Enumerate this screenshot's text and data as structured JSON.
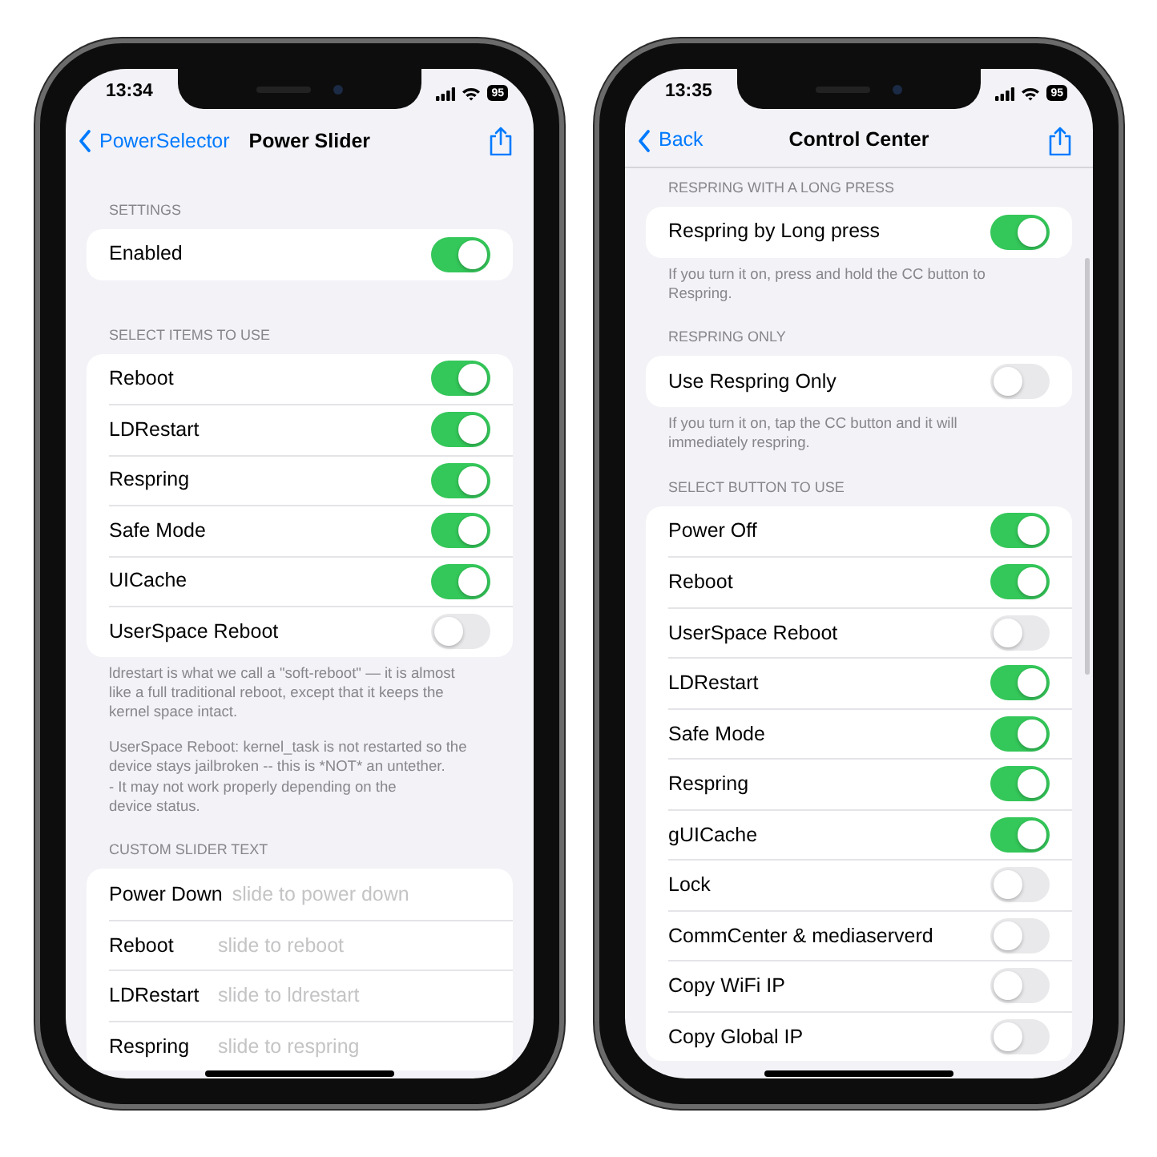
{
  "phones": [
    {
      "status_bar": {
        "time": "13:34",
        "battery": "95"
      },
      "nav": {
        "back": "PowerSelector",
        "title": "Power Slider"
      },
      "scrolled": false,
      "sections": [
        {
          "header": "SETTINGS",
          "rows": [
            {
              "kind": "switch",
              "label": "Enabled",
              "on": true
            }
          ]
        },
        {
          "header": "SELECT ITEMS TO USE",
          "rows": [
            {
              "kind": "switch",
              "label": "Reboot",
              "on": true
            },
            {
              "kind": "switch",
              "label": "LDRestart",
              "on": true
            },
            {
              "kind": "switch",
              "label": "Respring",
              "on": true
            },
            {
              "kind": "switch",
              "label": "Safe Mode",
              "on": true
            },
            {
              "kind": "switch",
              "label": "UICache",
              "on": true
            },
            {
              "kind": "switch",
              "label": "UserSpace Reboot",
              "on": false
            }
          ],
          "footer": [
            "ldrestart is what we call a \"soft-reboot\" — it is almost like a full traditional reboot, except that it keeps the kernel space intact.",
            "UserSpace Reboot: kernel_task is not restarted so the device stays jailbroken -- this is *NOT* an untether.\n- It may not work properly depending on the\ndevice status."
          ]
        },
        {
          "header": "CUSTOM SLIDER TEXT",
          "rows": [
            {
              "kind": "text_field",
              "label": "Power Down",
              "placeholder": "slide to power down"
            },
            {
              "kind": "text_field",
              "label": "Reboot",
              "placeholder": "slide to reboot"
            },
            {
              "kind": "text_field",
              "label": "LDRestart",
              "placeholder": "slide to ldrestart"
            },
            {
              "kind": "text_field",
              "label": "Respring",
              "placeholder": "slide to respring"
            }
          ]
        }
      ]
    },
    {
      "status_bar": {
        "time": "13:35",
        "battery": "95"
      },
      "nav": {
        "back": "Back",
        "title": "Control Center"
      },
      "scrolled": true,
      "sections": [
        {
          "header": "RESPRING WITH A LONG PRESS",
          "rows": [
            {
              "kind": "switch",
              "label": "Respring by Long press",
              "on": true
            }
          ],
          "footer": [
            "If you turn it on, press and hold the CC button to Respring."
          ]
        },
        {
          "header": "RESPRING ONLY",
          "rows": [
            {
              "kind": "switch",
              "label": "Use Respring Only",
              "on": false
            }
          ],
          "footer": [
            "If you turn it on, tap the CC button and it will immediately respring."
          ]
        },
        {
          "header": "SELECT BUTTON TO USE",
          "rows": [
            {
              "kind": "switch",
              "label": "Power Off",
              "on": true
            },
            {
              "kind": "switch",
              "label": "Reboot",
              "on": true
            },
            {
              "kind": "switch",
              "label": "UserSpace Reboot",
              "on": false
            },
            {
              "kind": "switch",
              "label": "LDRestart",
              "on": true
            },
            {
              "kind": "switch",
              "label": "Safe Mode",
              "on": true
            },
            {
              "kind": "switch",
              "label": "Respring",
              "on": true
            },
            {
              "kind": "switch",
              "label": "gUICache",
              "on": true
            },
            {
              "kind": "switch",
              "label": "Lock",
              "on": false
            },
            {
              "kind": "switch",
              "label": "CommCenter & mediaserverd",
              "on": false
            },
            {
              "kind": "switch",
              "label": "Copy WiFi IP",
              "on": false
            },
            {
              "kind": "switch",
              "label": "Copy Global IP",
              "on": false
            }
          ]
        }
      ]
    }
  ]
}
